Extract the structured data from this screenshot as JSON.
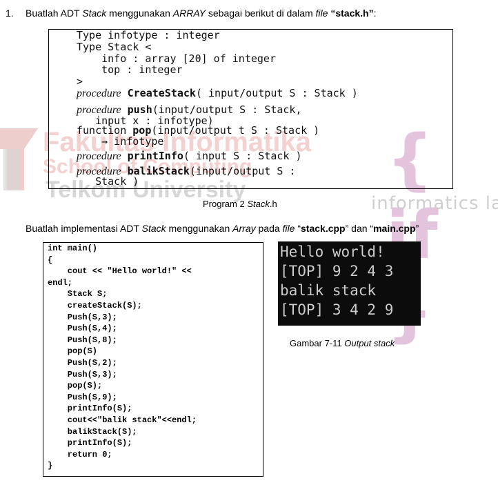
{
  "watermark": {
    "line1": "Fakultas Informatika",
    "line2": "School of Computing",
    "line3": "Telkom University",
    "logo_right": "{ if }",
    "logo_right_text": "informatics lab",
    "logo_color": "#c62a2a"
  },
  "item": {
    "number": "1.",
    "text_a": "Buatlah ADT ",
    "text_b": "Stack",
    "text_c": " menggunakan ",
    "text_d": "ARRAY",
    "text_e": " sebagai berikut di dalam ",
    "text_f": "file",
    "text_g": " “stack.h”",
    "text_h": ":"
  },
  "program2": {
    "lines": [
      "Type infotype : integer",
      "Type Stack <",
      "    info : array [20] of integer",
      "    top : integer",
      ">"
    ],
    "proc_kw": "procedure",
    "func_kw": "function",
    "createstack_name": "CreateStack",
    "createstack_args": "( input/output S : Stack )",
    "push_name": "push",
    "push_args": "(input/output S : Stack,",
    "push_args2": "   input x : infotype)",
    "pop_name": "pop",
    "pop_args": "(input/output t S : Stack )",
    "pop_ret": "    → infotype",
    "printinfo_name": "printInfo",
    "printinfo_args": "( input S : Stack )",
    "balik_name": "balikStack",
    "balik_args": "(input/output S :",
    "balik_args2": "   Stack )"
  },
  "caption1": {
    "a": "Program 2 ",
    "b": "Stack",
    "c": ".h"
  },
  "impl": {
    "a": "Buatlah implementasi ADT ",
    "b": "Stack",
    "c": " menggunakan ",
    "d": "Array",
    "e": " pada ",
    "f": "file",
    "g": " “",
    "h": "stack.cpp",
    "i": "” dan “",
    "j": "main.cpp",
    "k": "”"
  },
  "main_code": [
    "int main()",
    "{",
    "    cout << \"Hello world!\" <<",
    "endl;",
    "    Stack S;",
    "    createStack(S);",
    "    Push(S,3);",
    "    Push(S,4);",
    "    Push(S,8);",
    "    pop(S)",
    "    Push(S,2);",
    "    Push(S,3);",
    "    pop(S);",
    "    Push(S,9);",
    "    printInfo(S);",
    "    cout<<\"balik stack\"<<endl;",
    "    balikStack(S);",
    "    printInfo(S);",
    "    return 0;",
    "}"
  ],
  "console": [
    "Hello world!",
    "[TOP] 9 2 4 3",
    "balik stack",
    "[TOP] 3 4 2 9"
  ],
  "caption2": {
    "a": "Gambar 7-11 ",
    "b": "Output stack"
  }
}
